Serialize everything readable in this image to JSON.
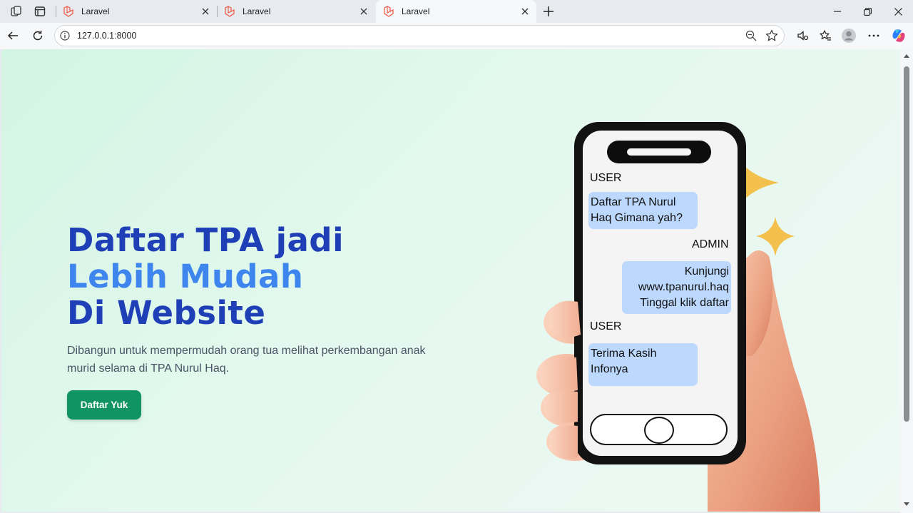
{
  "browser": {
    "tabs": [
      {
        "title": "Laravel",
        "active": false
      },
      {
        "title": "Laravel",
        "active": false
      },
      {
        "title": "Laravel",
        "active": true
      }
    ],
    "url": "127.0.0.1:8000",
    "icons": [
      "workspaces-icon",
      "tab-actions-icon",
      "laravel-icon",
      "close-icon",
      "new-tab-icon",
      "minimize-icon",
      "restore-icon",
      "close-window-icon",
      "back-icon",
      "refresh-icon",
      "site-info-icon",
      "zoom-icon",
      "favorite-star-icon",
      "read-aloud-icon",
      "favorites-icon",
      "profile-icon",
      "more-icon",
      "copilot-icon"
    ]
  },
  "hero": {
    "title_line1": "Daftar TPA jadi",
    "title_line2": "Lebih Mudah",
    "title_line3": "Di Website",
    "description": "Dibangun untuk mempermudah orang tua melihat perkembangan anak murid selama di TPA Nurul Haq.",
    "cta_label": "Daftar Yuk"
  },
  "chat": {
    "sender1": "USER",
    "message1": "Daftar TPA Nurul Haq Gimana yah?",
    "sender2": "ADMIN",
    "message2": "Kunjungi www.tpanurul.haq Tinggal klik daftar",
    "sender3": "USER",
    "message3": "Terima Kasih Infonya"
  },
  "colors": {
    "title_dark": "#1f3fb7",
    "title_light": "#3e86ee",
    "cta": "#119463",
    "bubble": "#bcd8fd",
    "sparkle": "#f4c04d"
  }
}
